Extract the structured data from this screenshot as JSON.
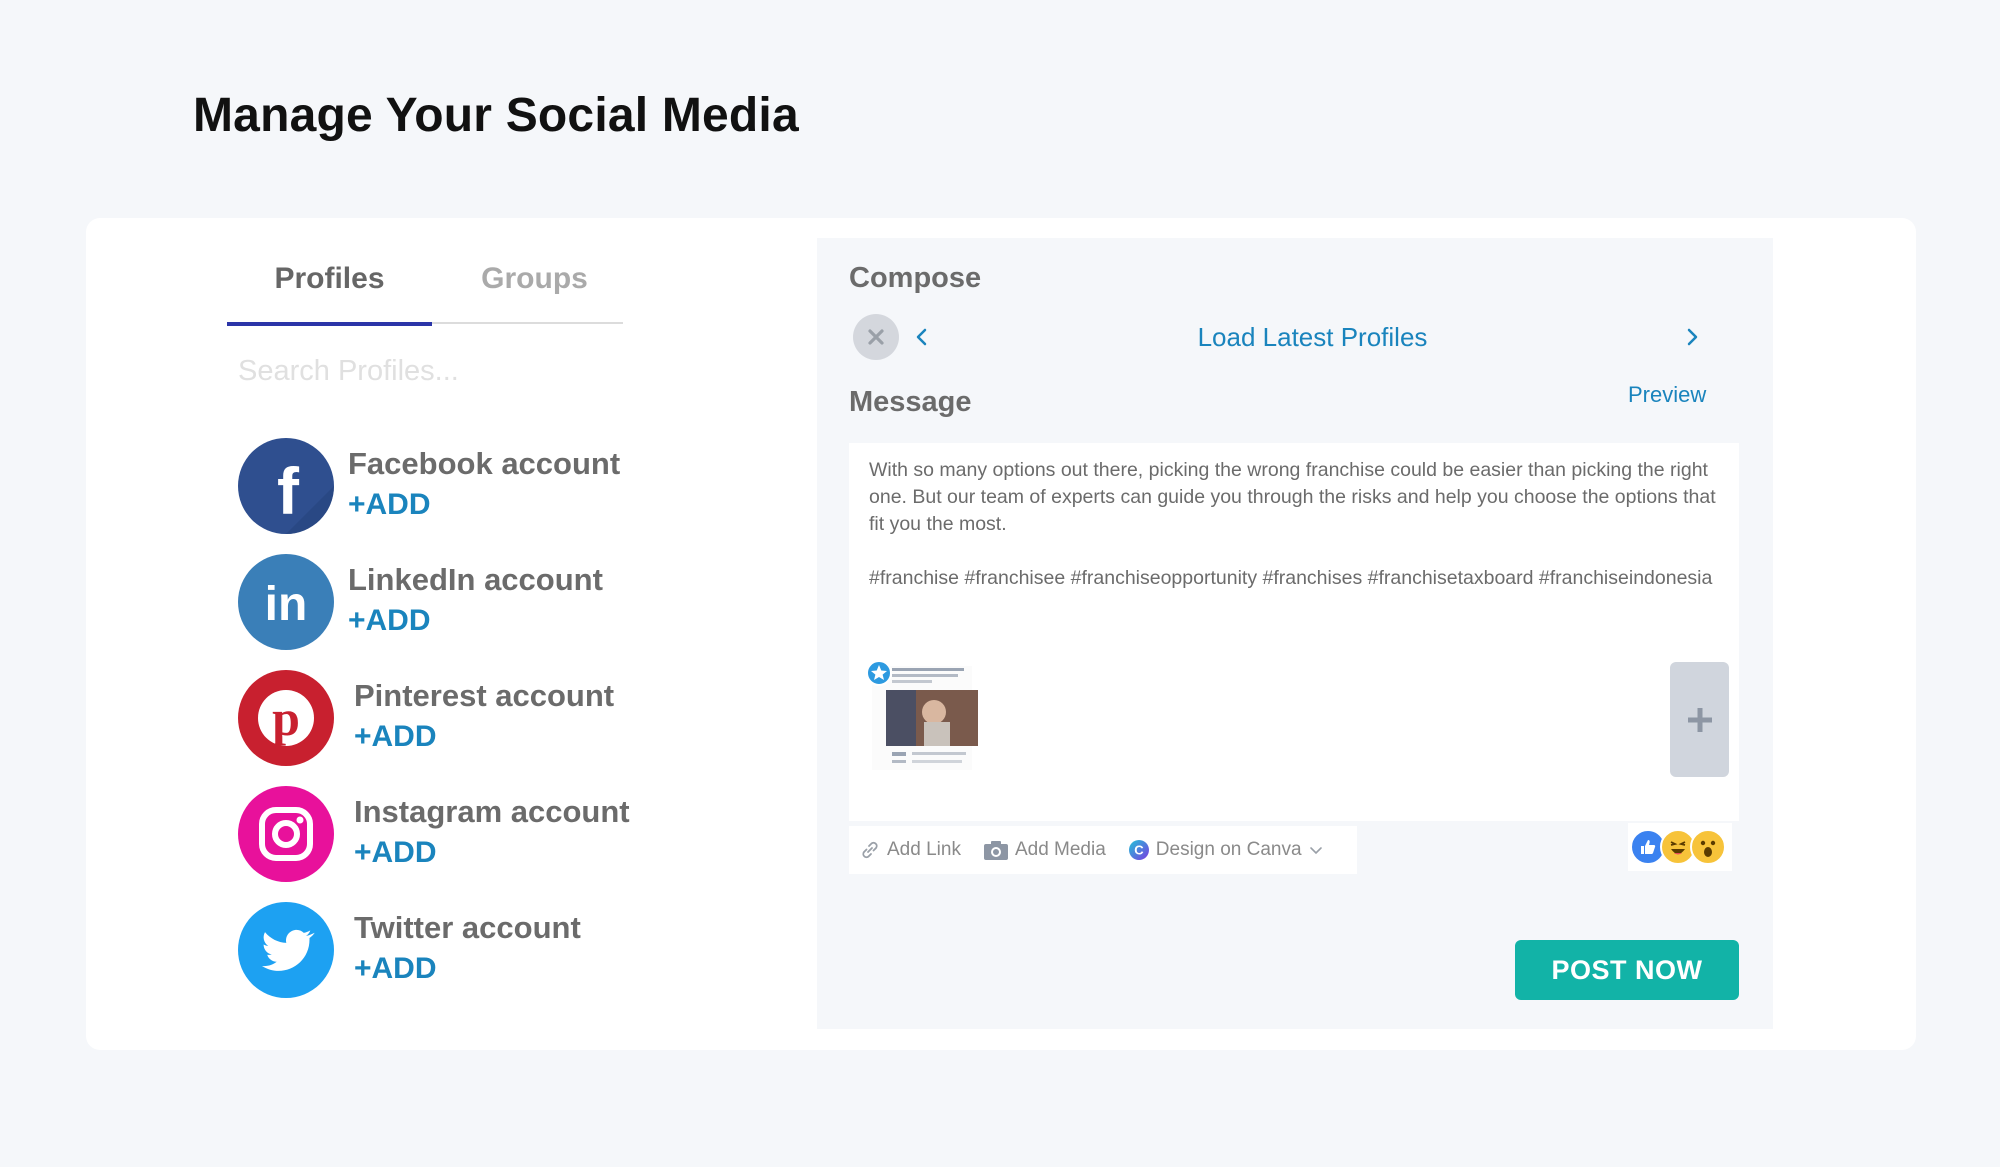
{
  "page": {
    "title": "Manage Your Social Media"
  },
  "tabs": [
    {
      "label": "Profiles",
      "active": true
    },
    {
      "label": "Groups",
      "active": false
    }
  ],
  "search": {
    "placeholder": "Search Profiles..."
  },
  "profiles": [
    {
      "name": "Facebook account",
      "action": "+ADD",
      "icon": "facebook-icon",
      "color": "#2f4f8f"
    },
    {
      "name": "LinkedIn account",
      "action": "+ADD",
      "icon": "linkedin-icon",
      "color": "#3a7fb8"
    },
    {
      "name": "Pinterest account",
      "action": "+ADD",
      "icon": "pinterest-icon",
      "color": "#c8202f"
    },
    {
      "name": "Instagram account",
      "action": "+ADD",
      "icon": "instagram-icon",
      "color": "#e8119b"
    },
    {
      "name": "Twitter account",
      "action": "+ADD",
      "icon": "twitter-icon",
      "color": "#1da1f2"
    }
  ],
  "compose": {
    "title": "Compose",
    "load_latest": "Load Latest Profiles",
    "message_label": "Message",
    "preview": "Preview",
    "message_text": "With so many options out there, picking the wrong franchise could be easier than picking the right one. But our team of experts can guide you through the risks and help you choose the options that fit you the most.\n\n#franchise #franchisee #franchiseopportunity #franchises #franchisetaxboard #franchiseindonesia",
    "toolbar": {
      "add_link": "Add Link",
      "add_media": "Add Media",
      "design_canva": "Design on Canva"
    },
    "post_now": "POST NOW"
  },
  "colors": {
    "accent": "#1a84bd",
    "tab_underline": "#2b35a8",
    "post_button": "#12b3a7"
  }
}
